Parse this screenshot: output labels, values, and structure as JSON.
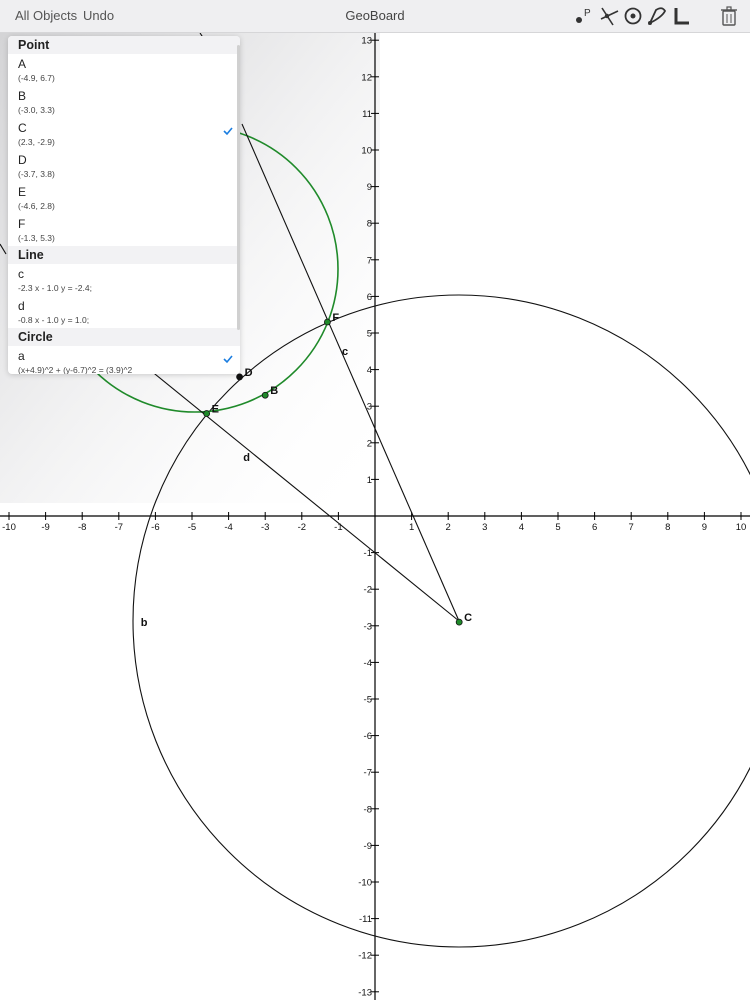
{
  "toolbar": {
    "all_objects": "All Objects",
    "undo": "Undo",
    "title": "GeoBoard",
    "point_tool_letter": "P",
    "tools": [
      "point-tool-icon",
      "line-tool-icon",
      "circle-tool-icon",
      "compass-tool-icon",
      "angle-tool-icon",
      "trash-icon"
    ]
  },
  "panel": {
    "sections": [
      {
        "title": "Point",
        "items": [
          {
            "name": "A",
            "value": "(-4.9, 6.7)",
            "checked": false
          },
          {
            "name": "B",
            "value": "(-3.0, 3.3)",
            "checked": false
          },
          {
            "name": "C",
            "value": "(2.3, -2.9)",
            "checked": true
          },
          {
            "name": "D",
            "value": "(-3.7, 3.8)",
            "checked": false
          },
          {
            "name": "E",
            "value": "(-4.6, 2.8)",
            "checked": false
          },
          {
            "name": "F",
            "value": "(-1.3, 5.3)",
            "checked": false
          }
        ]
      },
      {
        "title": "Line",
        "items": [
          {
            "name": "c",
            "value": "-2.3 x - 1.0 y = -2.4;",
            "checked": false
          },
          {
            "name": "d",
            "value": "-0.8 x - 1.0 y = 1.0;",
            "checked": false
          }
        ]
      },
      {
        "title": "Circle",
        "items": [
          {
            "name": "a",
            "value": "(x+4.9)^2 + (y-6.7)^2 = (3.9)^2",
            "checked": true
          }
        ]
      }
    ]
  },
  "board": {
    "x_ticks": [
      -10,
      -9,
      -8,
      -7,
      -6,
      -5,
      -4,
      -3,
      -2,
      -1,
      1,
      2,
      3,
      4,
      5,
      6,
      7,
      8,
      9,
      10
    ],
    "y_ticks": [
      13,
      12,
      11,
      10,
      9,
      8,
      7,
      6,
      5,
      4,
      3,
      2,
      1,
      -1,
      -2,
      -3,
      -4,
      -5,
      -6,
      -7,
      -8,
      -9,
      -10,
      -11,
      -12,
      -13
    ],
    "points": [
      {
        "label": "B",
        "x": -3.0,
        "y": 3.3
      },
      {
        "label": "C",
        "x": 2.3,
        "y": -2.9
      },
      {
        "label": "D",
        "x": -3.7,
        "y": 3.8
      },
      {
        "label": "E",
        "x": -4.6,
        "y": 2.8
      },
      {
        "label": "F",
        "x": -1.3,
        "y": 5.3
      }
    ],
    "line_labels": [
      {
        "label": "c",
        "x": -0.9,
        "y": 4.4
      },
      {
        "label": "d",
        "x": -3.6,
        "y": 1.5
      }
    ],
    "circle_labels": [
      {
        "label": "b",
        "x": -6.4,
        "y": -3.0
      }
    ],
    "colors": {
      "accent": "#1a7de0",
      "circle_a": "#1f8a2a",
      "point_fill": "#1f8a2a",
      "axis": "#000000"
    }
  }
}
